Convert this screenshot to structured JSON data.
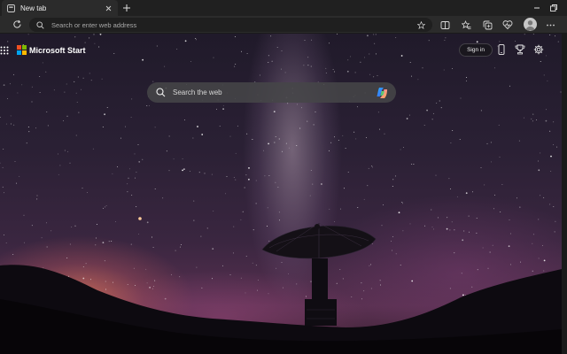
{
  "browser": {
    "tab": {
      "title": "New tab",
      "icon": "new-tab-page-icon"
    },
    "new_tab_icon": "plus-icon",
    "window_controls": [
      "minimize-icon",
      "restore-icon"
    ],
    "address_bar": {
      "placeholder": "Search or enter web address",
      "value": ""
    },
    "toolbar_icons": [
      "split-screen-icon",
      "favorites-icon",
      "collections-icon",
      "browser-essentials-icon",
      "profile-avatar",
      "more-menu-icon"
    ]
  },
  "page": {
    "brand": "Microsoft Start",
    "logo_colors": [
      "#f25022",
      "#7fba00",
      "#00a4ef",
      "#ffb900"
    ],
    "signin_label": "Sign in",
    "search": {
      "placeholder": "Search the web",
      "value": ""
    },
    "right_icons": [
      "mobile-icon",
      "rewards-icon",
      "settings-icon"
    ],
    "background": "night sky with milky way and radio telescope dish"
  }
}
